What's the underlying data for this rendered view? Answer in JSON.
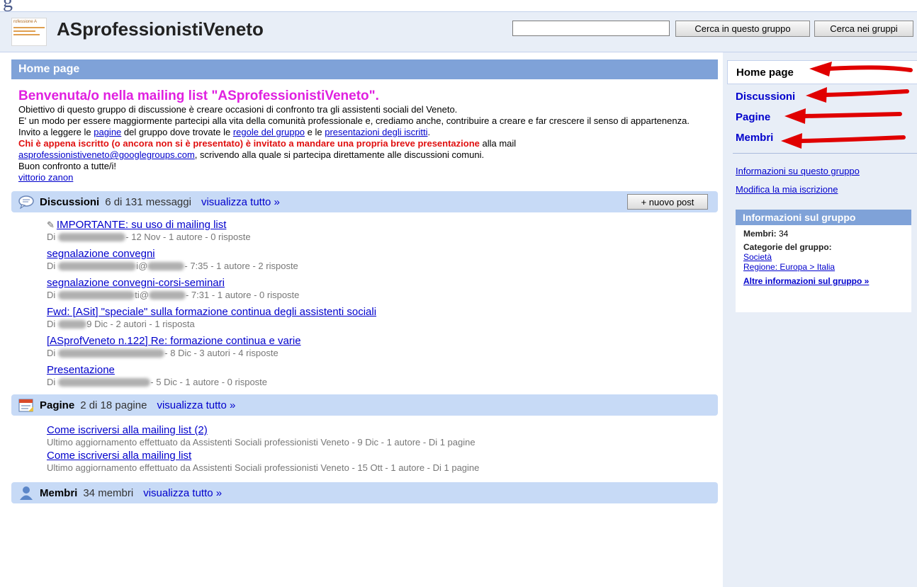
{
  "header": {
    "group_title": "ASprofessionistiVeneto",
    "logo_text": "rofessione A",
    "search_value": "",
    "btn_search_group": "Cerca in questo gruppo",
    "btn_search_all": "Cerca nei gruppi"
  },
  "main": {
    "home_bar": "Home page",
    "welcome": {
      "title": "Benvenuta/o nella mailing list \"ASprofessionistiVeneto\".",
      "p1": "Obiettivo di questo gruppo di discussione è creare occasioni di confronto tra gli assistenti sociali del Veneto.",
      "p2": "E' un modo per essere maggiormente partecipi alla vita della comunità professionale e, crediamo anche, contribuire a creare e far crescere il senso di appartenenza.",
      "p3_a": "Invito a leggere le ",
      "p3_link1": "pagine",
      "p3_b": " del gruppo dove trovate le ",
      "p3_link2": "regole del gruppo",
      "p3_c": " e le ",
      "p3_link3": "presentazioni degli iscritti",
      "p3_d": ".",
      "p4_red": "Chi è appena iscritto (o ancora non si è presentato) è invitato a mandare una propria breve presentazione",
      "p4_rest": " alla mail",
      "p5_email": "asprofessionistiveneto@googlegroups.com",
      "p5_rest": ", scrivendo alla quale si partecipa direttamente alle discussioni comuni.",
      "p6": "Buon confronto a tutte/i!",
      "signature": "vittorio zanon"
    },
    "discussions": {
      "title": "Discussioni",
      "count": "6 di 131 messaggi",
      "view_all": "visualizza tutto »",
      "new_post": "+ nuovo post",
      "threads": [
        {
          "title": "IMPORTANTE: su uso di mailing list",
          "pinned": true,
          "prefix": "Di",
          "mid": "",
          "meta": " - 12 Nov - 1 autore - 0 risposte"
        },
        {
          "title": "segnalazione convegni",
          "pinned": false,
          "prefix": "Di",
          "mid": "i@",
          "meta": " - 7:35 - 1 autore - 2 risposte"
        },
        {
          "title": "segnalazione convegni-corsi-seminari",
          "pinned": false,
          "prefix": "Di",
          "mid": "ti@",
          "meta": " - 7:31 - 1 autore - 0 risposte"
        },
        {
          "title": "Fwd: [ASit] \"speciale\" sulla formazione continua degli assistenti sociali",
          "pinned": false,
          "prefix": "Di",
          "mid": "",
          "meta": " 9 Dic - 2 autori - 1 risposta"
        },
        {
          "title": "[ASprofVeneto n.122] Re: formazione continua e varie",
          "pinned": false,
          "prefix": "Di",
          "mid": "",
          "meta": " - 8 Dic - 3 autori - 4 risposte"
        },
        {
          "title": "Presentazione",
          "pinned": false,
          "prefix": "Di",
          "mid": "",
          "meta": " - 5 Dic - 1 autore - 0 risposte"
        }
      ]
    },
    "pages": {
      "title": "Pagine",
      "count": "2 di 18 pagine",
      "view_all": "visualizza tutto »",
      "items": [
        {
          "title": "Come iscriversi alla mailing list (2)",
          "meta": "Ultimo aggiornamento effettuato da Assistenti Sociali professionisti Veneto - 9 Dic - 1 autore - Di 1 pagine"
        },
        {
          "title": "Come iscriversi alla mailing list",
          "meta": "Ultimo aggiornamento effettuato da Assistenti Sociali professionisti Veneto - 15 Ott - 1 autore - Di 1 pagine"
        }
      ]
    },
    "members": {
      "title": "Membri",
      "count": "34 membri",
      "view_all": "visualizza tutto »"
    }
  },
  "sidebar": {
    "nav_home": "Home page",
    "nav_discussions": "Discussioni",
    "nav_pages": "Pagine",
    "nav_members": "Membri",
    "link_info": "Informazioni su questo gruppo",
    "link_modify": "Modifica la mia iscrizione",
    "info_box": {
      "title": "Informazioni sul gruppo",
      "members_label": "Membri:",
      "members_value": " 34",
      "categories_label": "Categorie del gruppo:",
      "cat1": "Società",
      "cat2": "Regione: Europa > Italia",
      "more": "Altre informazioni sul gruppo »"
    }
  },
  "colors": {
    "accent_bar": "#7fa2d8",
    "section_bar": "#c7daf6",
    "header_bg": "#e8eef7",
    "welcome_title": "#e020e0",
    "red_text": "#e01010",
    "arrow": "#e00000"
  }
}
